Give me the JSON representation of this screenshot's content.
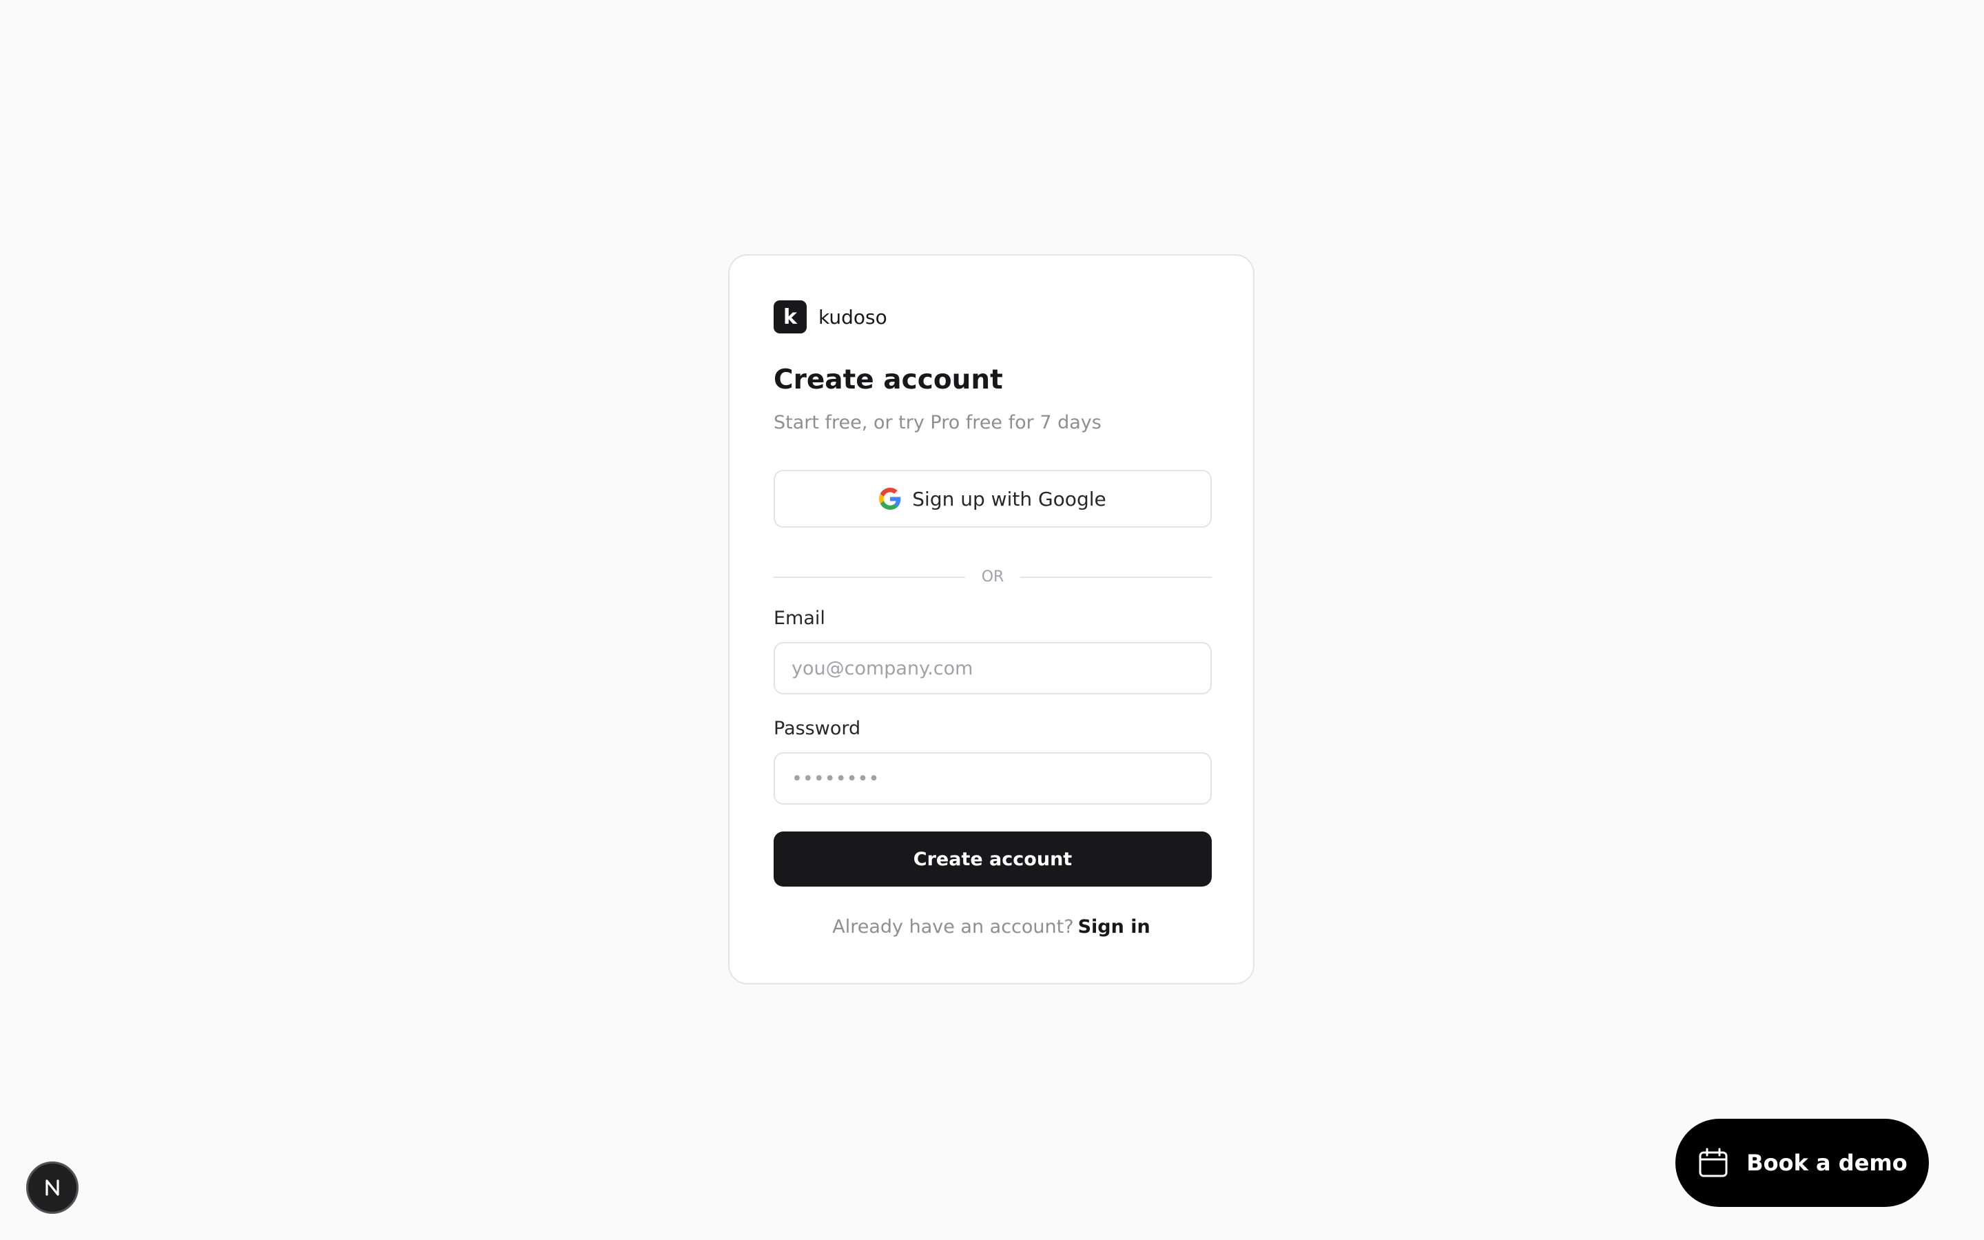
{
  "brand": {
    "logo_letter": "k",
    "name": "kudoso"
  },
  "signup": {
    "heading": "Create account",
    "subheading": "Start free, or try Pro free for 7 days",
    "google_button_label": "Sign up with Google",
    "divider_text": "OR",
    "email_label": "Email",
    "email_placeholder": "you@company.com",
    "email_value": "",
    "password_label": "Password",
    "password_placeholder": "••••••••",
    "password_value": "",
    "submit_label": "Create account",
    "footer_text": "Already have an account?",
    "signin_link": "Sign in"
  },
  "floating": {
    "demo_label": "Book a demo",
    "demo_icon": "calendar-icon",
    "dev_badge_icon": "nextjs-icon"
  },
  "colors": {
    "primary": "#18181b",
    "background": "#fafafa",
    "border": "#e4e4e7",
    "muted_text": "#8e8e93"
  }
}
